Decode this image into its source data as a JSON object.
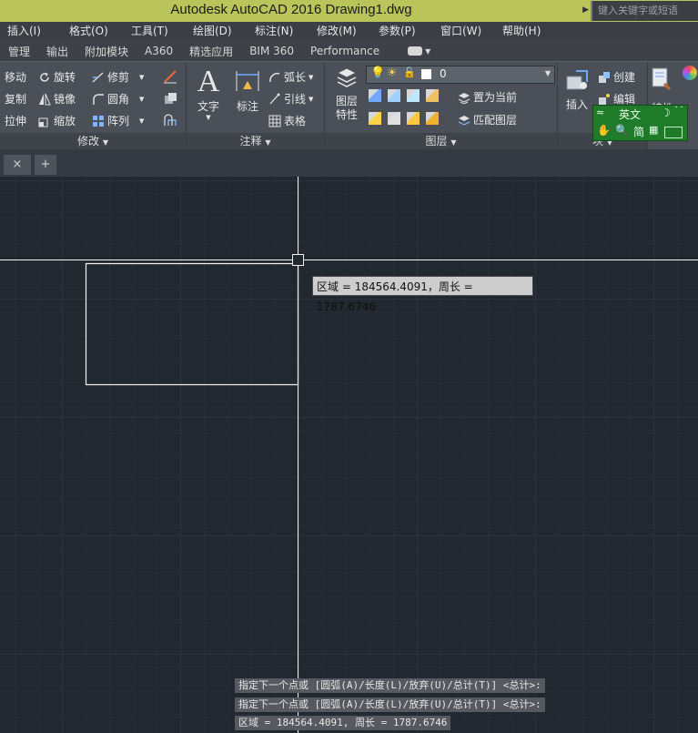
{
  "title_bar": {
    "app_title": "Autodesk AutoCAD 2016    Drawing1.dwg",
    "search_placeholder": "键入关键字或短语"
  },
  "menu": {
    "items": [
      "插入(I)",
      "格式(O)",
      "工具(T)",
      "绘图(D)",
      "标注(N)",
      "修改(M)",
      "参数(P)",
      "窗口(W)",
      "帮助(H)"
    ]
  },
  "ribbon_tabs": [
    "管理",
    "输出",
    "附加模块",
    "A360",
    "精选应用",
    "BIM 360",
    "Performance"
  ],
  "ribbon": {
    "modify": {
      "title": "修改",
      "move": "移动",
      "rotate": "旋转",
      "trim": "修剪",
      "copy": "复制",
      "mirror": "镜像",
      "fillet": "圆角",
      "stretch": "拉伸",
      "scale": "缩放",
      "array": "阵列"
    },
    "annotation": {
      "title": "注释",
      "text": "文字",
      "dimension": "标注",
      "arc_length": "弧长",
      "leader": "引线",
      "table": "表格"
    },
    "layers": {
      "title": "图层",
      "layer_properties_1": "图层",
      "layer_properties_2": "特性",
      "current_layer": "0",
      "set_current": "置为当前",
      "match_layer": "匹配图层"
    },
    "block": {
      "title": "块",
      "insert": "插入",
      "create": "创建",
      "edit": "编辑"
    },
    "properties_partial": "特性"
  },
  "ime": {
    "mode": "英文",
    "charset": "简"
  },
  "file_tabs": {
    "close": "×",
    "add": "+"
  },
  "tooltip": {
    "text": "区域 = 184564.4091，周长 = 1787.6746"
  },
  "command_history": [
    "指定下一个点或 [圆弧(A)/长度(L)/放弃(U)/总计(T)] <总计>:",
    "指定下一个点或 [圆弧(A)/长度(L)/放弃(U)/总计(T)] <总计>:",
    "区域 = 184564.4091, 周长 = 1787.6746"
  ],
  "colors": {
    "canvas_bg": "#212830",
    "title_bar": "#b9c45b",
    "ime_green": "#1f7a2a"
  }
}
